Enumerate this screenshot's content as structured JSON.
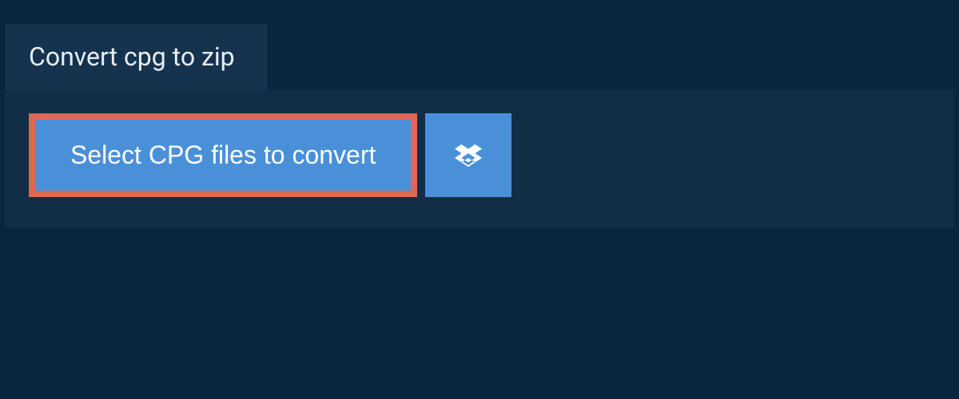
{
  "tab": {
    "title": "Convert cpg to zip"
  },
  "actions": {
    "select_label": "Select CPG files to convert"
  }
}
